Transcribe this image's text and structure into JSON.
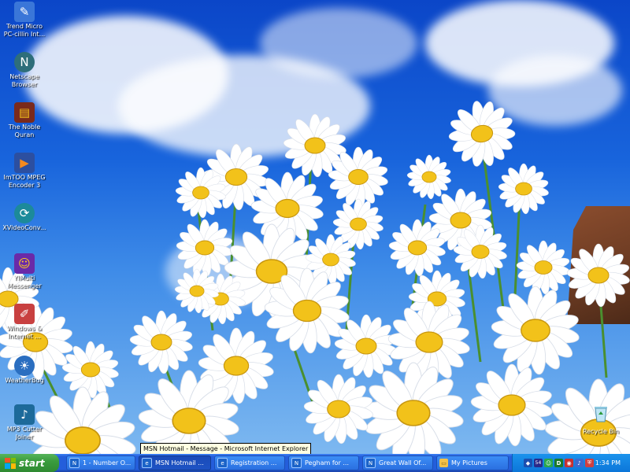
{
  "desktop_icons": [
    {
      "id": "trend-micro",
      "label": "Trend Micro PC-cillin Int...",
      "icon": "trend-micro-icon",
      "color": "#3a76d8"
    },
    {
      "id": "netscape",
      "label": "Netscape Browser",
      "icon": "netscape-icon",
      "color": "#2e6e7a"
    },
    {
      "id": "noble-quran",
      "label": "The Noble Quran",
      "icon": "book-icon",
      "color": "#7a2a1c"
    },
    {
      "id": "imtoo",
      "label": "ImTOO MPEG Encoder 3",
      "icon": "film-icon",
      "color": "#2c4fa0"
    },
    {
      "id": "xvideoconv",
      "label": "XVideoConv...",
      "icon": "video-convert-icon",
      "color": "#1c8a9a"
    },
    {
      "id": "yimulti",
      "label": "YIMulti Messenger",
      "icon": "messenger-icon",
      "color": "#6a2aa8"
    },
    {
      "id": "windows-internet",
      "label": "Windows & Internet ...",
      "icon": "pencil-icon",
      "color": "#c84040"
    },
    {
      "id": "weatherbug",
      "label": "WeatherBug",
      "icon": "weather-icon",
      "color": "#2a6ec0"
    },
    {
      "id": "mp3-cutter",
      "label": "MP3 Cutter Joiner",
      "icon": "audio-icon",
      "color": "#1d6a9a"
    }
  ],
  "recycle_bin": {
    "label": "Recycle Bin"
  },
  "tooltip": "MSN Hotmail - Message - Microsoft Internet Explorer",
  "taskbar": {
    "start_label": "start",
    "tasks": [
      {
        "label": "1 - Number O...",
        "icon": "ie-icon",
        "active": false
      },
      {
        "label": "MSN Hotmail ...",
        "icon": "ie-icon",
        "active": true
      },
      {
        "label": "Registration ...",
        "icon": "ie-icon",
        "active": false
      },
      {
        "label": "Pegham for ...",
        "icon": "ie-icon",
        "active": false
      },
      {
        "label": "Great Wall Of...",
        "icon": "ie-icon",
        "active": false
      },
      {
        "label": "My Pictures",
        "icon": "folder-icon",
        "active": false
      }
    ],
    "tray_icons": [
      "network-icon",
      "tray-54-icon",
      "messenger-tray-icon",
      "d-icon",
      "antivirus-icon",
      "volume-icon",
      "security-icon"
    ],
    "tray_number": "54",
    "tray_letter": "D",
    "clock": "1:34 PM"
  }
}
